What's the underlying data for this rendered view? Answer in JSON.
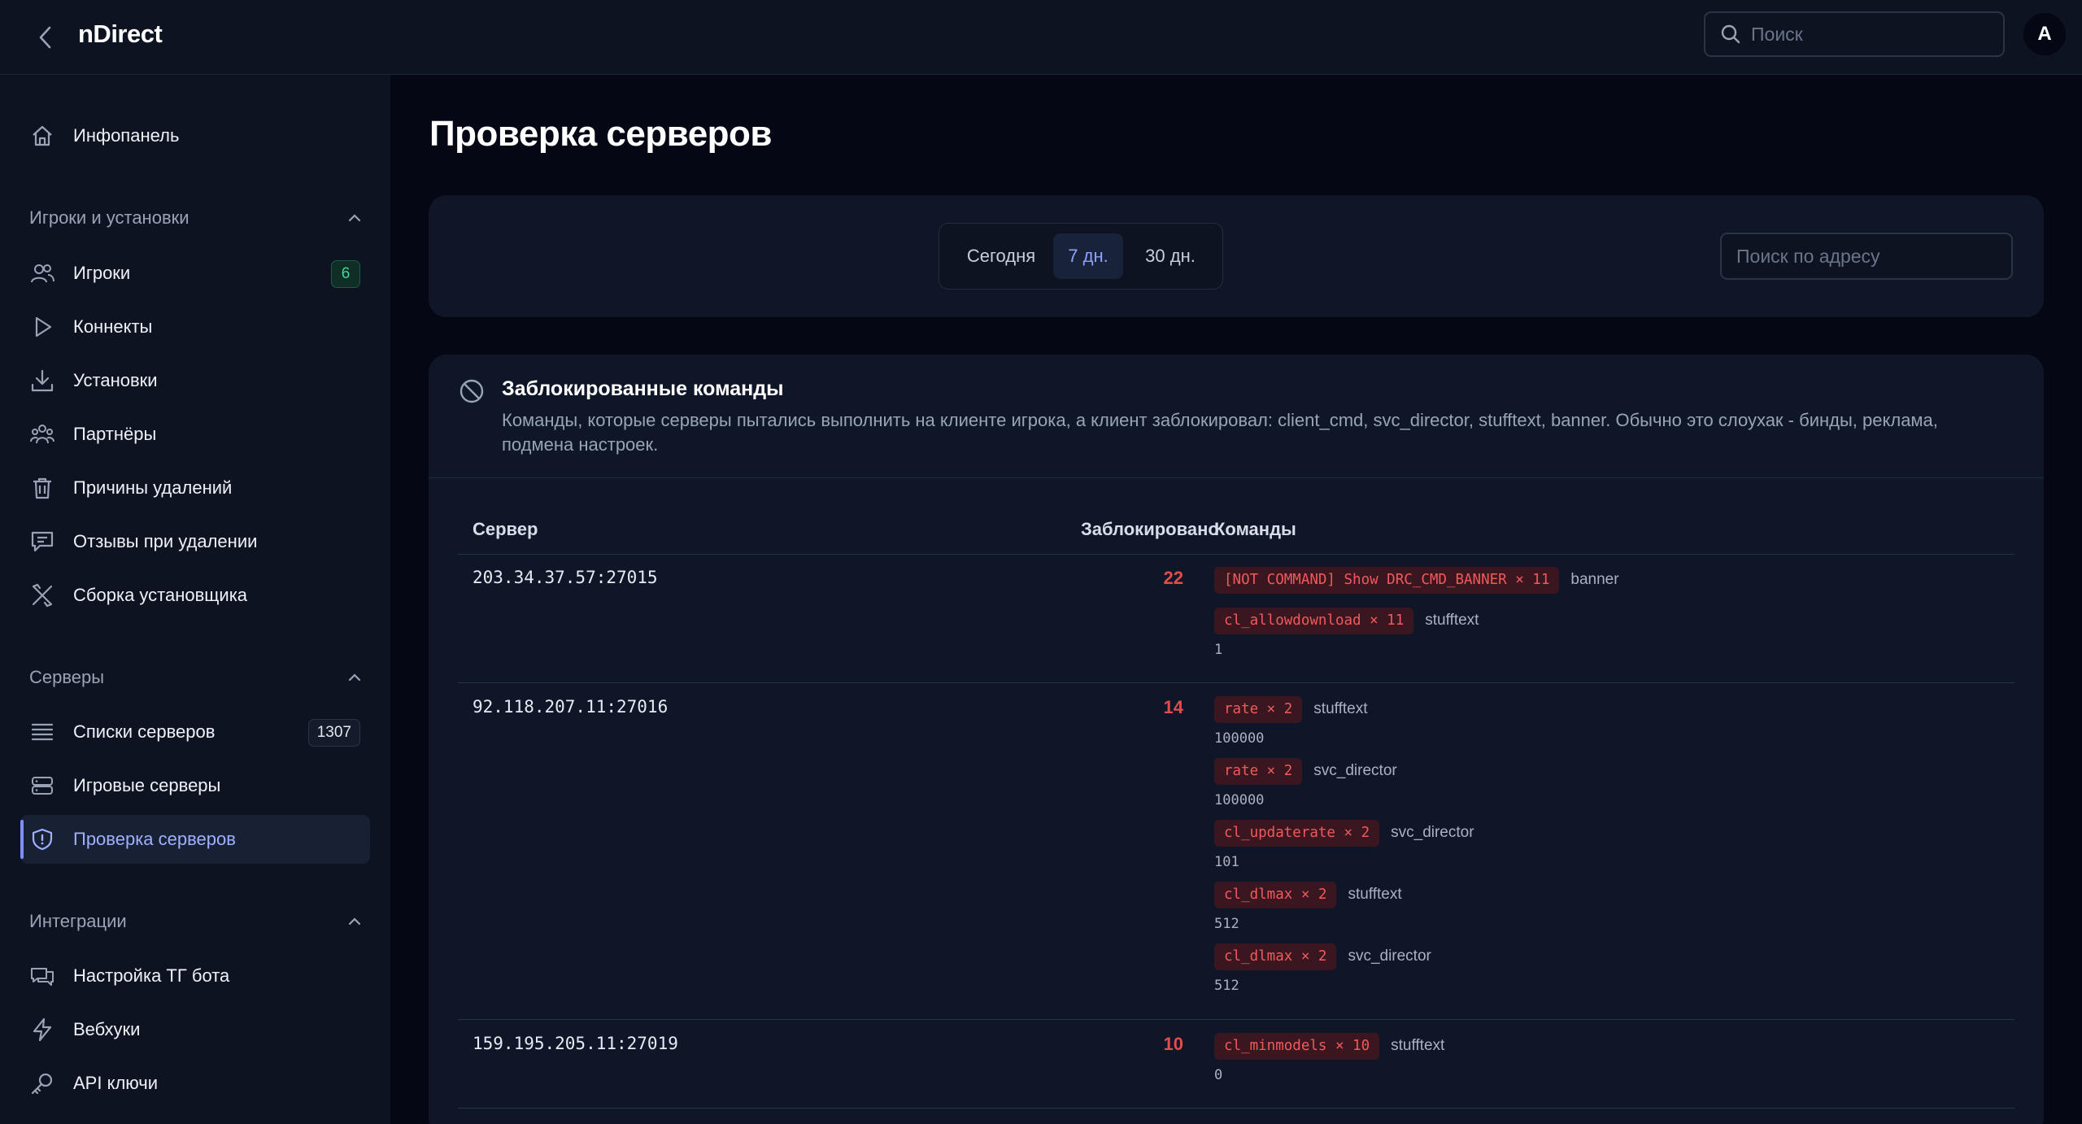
{
  "app": {
    "title": "nDirect",
    "search_placeholder": "Поиск",
    "avatar_letter": "A"
  },
  "sidebar": {
    "dashboard": "Инфопанель",
    "sections": [
      {
        "title": "Игроки и установки",
        "items": [
          {
            "label": "Игроки",
            "badge": "6"
          },
          {
            "label": "Коннекты"
          },
          {
            "label": "Установки"
          },
          {
            "label": "Партнёры"
          },
          {
            "label": "Причины удалений"
          },
          {
            "label": "Отзывы при удалении"
          },
          {
            "label": "Сборка установщика"
          }
        ]
      },
      {
        "title": "Серверы",
        "items": [
          {
            "label": "Списки серверов",
            "badge": "1307"
          },
          {
            "label": "Игровые серверы"
          },
          {
            "label": "Проверка серверов"
          }
        ]
      },
      {
        "title": "Интеграции",
        "items": [
          {
            "label": "Настройка ТГ бота"
          },
          {
            "label": "Вебхуки"
          },
          {
            "label": "API ключи"
          }
        ]
      }
    ]
  },
  "main": {
    "title": "Проверка серверов",
    "periods": [
      "Сегодня",
      "7 дн.",
      "30 дн."
    ],
    "active_period": "7 дн.",
    "address_search_placeholder": "Поиск по адресу",
    "blocked": {
      "title": "Заблокированные команды",
      "description": "Команды, которые серверы пытались выполнить на клиенте игрока, а клиент заблокировал: client_cmd, svc_director, stufftext, banner. Обычно это слоухак - бинды, реклама, подмена настроек.",
      "columns": [
        "Сервер",
        "Заблокировано",
        "Команды"
      ],
      "rows": [
        {
          "server": "203.34.37.57:27015",
          "count": "22",
          "commands": [
            {
              "chip": "[NOT COMMAND] Show DRC_CMD_BANNER × 11",
              "type": "banner"
            },
            {
              "chip": "cl_allowdownload × 11",
              "type": "stufftext",
              "value": "1"
            }
          ]
        },
        {
          "server": "92.118.207.11:27016",
          "count": "14",
          "commands": [
            {
              "chip": "rate × 2",
              "type": "stufftext",
              "value": "100000"
            },
            {
              "chip": "rate × 2",
              "type": "svc_director",
              "value": "100000"
            },
            {
              "chip": "cl_updaterate × 2",
              "type": "svc_director",
              "value": "101"
            },
            {
              "chip": "cl_dlmax × 2",
              "type": "stufftext",
              "value": "512"
            },
            {
              "chip": "cl_dlmax × 2",
              "type": "svc_director",
              "value": "512"
            }
          ]
        },
        {
          "server": "159.195.205.11:27019",
          "count": "10",
          "commands": [
            {
              "chip": "cl_minmodels × 10",
              "type": "stufftext",
              "value": "0"
            }
          ]
        }
      ]
    }
  }
}
